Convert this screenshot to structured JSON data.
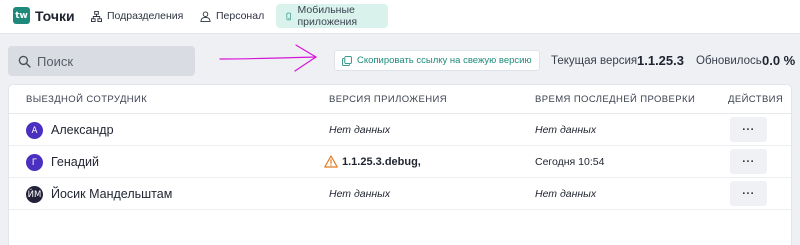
{
  "app": {
    "logo_text": "tw",
    "title": "Точки"
  },
  "nav": [
    {
      "label": "Подразделения",
      "icon": "org-chart-icon"
    },
    {
      "label": "Персонал",
      "icon": "user-icon"
    },
    {
      "label": "Мобильные приложения",
      "icon": "mobile-phone-icon",
      "active": true
    }
  ],
  "search": {
    "placeholder": "Поиск",
    "value": ""
  },
  "toolbar": {
    "copy_link_label": "Скопировать ссылку на свежую версию",
    "current_version_label": "Текущая версия",
    "current_version_value": "1.1.25.3",
    "updated_label": "Обновилось",
    "updated_value": "0.0 %"
  },
  "table": {
    "columns": [
      "Выездной сотрудник",
      "Версия приложения",
      "Время последней проверки",
      "Действия"
    ],
    "rows": [
      {
        "initials": "А",
        "name": "Александр",
        "version": "Нет данных",
        "warning": false,
        "last_check": "Нет данных",
        "action": "···"
      },
      {
        "initials": "Г",
        "name": "Генадий",
        "version": "1.1.25.3.debug,",
        "warning": true,
        "last_check": "Сегодня 10:54",
        "action": "···"
      },
      {
        "initials": "ЙМ",
        "name": "Йосик Мандельштам",
        "version": "Нет данных",
        "warning": false,
        "last_check": "Нет данных",
        "action": "···"
      }
    ]
  },
  "colors": {
    "brand": "#1f8a7c",
    "active_tab_bg": "#d9f3ec",
    "avatar_purple": "#4a2fc0",
    "avatar_dark": "#22213a",
    "arrow": "#d616d6",
    "warning": "#e07a1f"
  }
}
